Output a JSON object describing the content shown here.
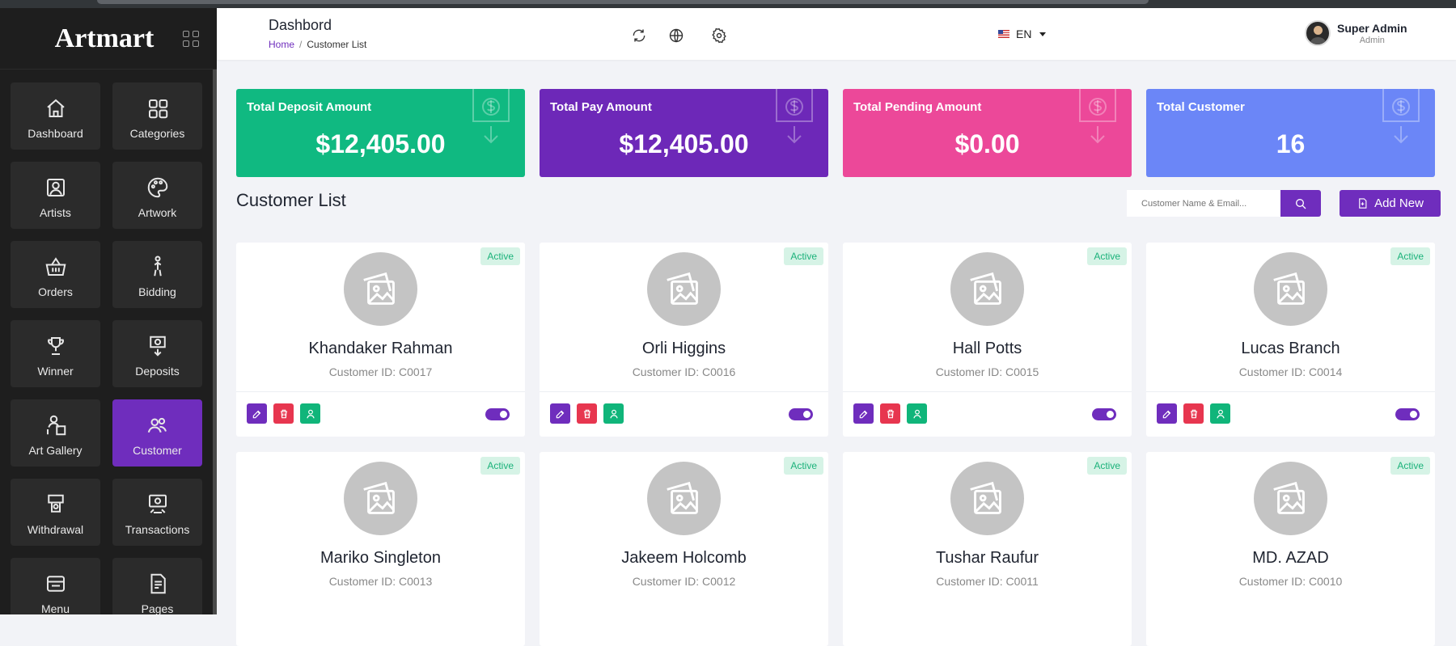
{
  "brand": {
    "name": "Artmart"
  },
  "sidebar": {
    "items": [
      {
        "label": "Dashboard",
        "icon": "home-icon",
        "active": false
      },
      {
        "label": "Categories",
        "icon": "categories-icon",
        "active": false
      },
      {
        "label": "Artists",
        "icon": "artist-icon",
        "active": false
      },
      {
        "label": "Artwork",
        "icon": "palette-icon",
        "active": false
      },
      {
        "label": "Orders",
        "icon": "basket-icon",
        "active": false
      },
      {
        "label": "Bidding",
        "icon": "bidding-icon",
        "active": false
      },
      {
        "label": "Winner",
        "icon": "trophy-icon",
        "active": false
      },
      {
        "label": "Deposits",
        "icon": "deposit-icon",
        "active": false
      },
      {
        "label": "Art Gallery",
        "icon": "gallery-icon",
        "active": false
      },
      {
        "label": "Customer",
        "icon": "customer-icon",
        "active": true
      },
      {
        "label": "Withdrawal",
        "icon": "withdrawal-icon",
        "active": false
      },
      {
        "label": "Transactions",
        "icon": "transactions-icon",
        "active": false
      },
      {
        "label": "Menu",
        "icon": "menu-icon",
        "active": false
      },
      {
        "label": "Pages",
        "icon": "pages-icon",
        "active": false
      }
    ]
  },
  "header": {
    "title": "Dashbord",
    "breadcrumb": {
      "home": "Home",
      "sep": "/",
      "current": "Customer List"
    },
    "language": "EN",
    "user": {
      "name": "Super Admin",
      "role": "Admin"
    }
  },
  "stats": [
    {
      "title": "Total Deposit Amount",
      "value": "$12,405.00",
      "color": "#10b981"
    },
    {
      "title": "Total Pay Amount",
      "value": "$12,405.00",
      "color": "#6d28b8"
    },
    {
      "title": "Total Pending Amount",
      "value": "$0.00",
      "color": "#ec4899"
    },
    {
      "title": "Total Customer",
      "value": "16",
      "color": "#6b86f7"
    }
  ],
  "customer_list": {
    "title": "Customer List",
    "search_placeholder": "Customer Name & Email...",
    "add_label": "Add New",
    "status_label": "Active",
    "customers": [
      {
        "name": "Khandaker Rahman",
        "id": "Customer ID: C0017"
      },
      {
        "name": "Orli Higgins",
        "id": "Customer ID: C0016"
      },
      {
        "name": "Hall Potts",
        "id": "Customer ID: C0015"
      },
      {
        "name": "Lucas Branch",
        "id": "Customer ID: C0014"
      },
      {
        "name": "Mariko Singleton",
        "id": "Customer ID: C0013"
      },
      {
        "name": "Jakeem Holcomb",
        "id": "Customer ID: C0012"
      },
      {
        "name": "Tushar Raufur",
        "id": "Customer ID: C0011"
      },
      {
        "name": "MD. AZAD",
        "id": "Customer ID: C0010"
      }
    ]
  }
}
